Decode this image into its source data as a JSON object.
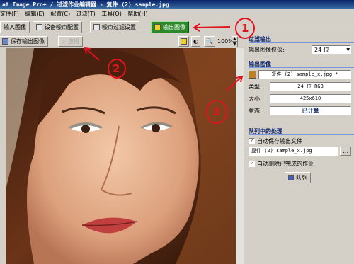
{
  "window": {
    "title": "at Image Pro+ / 过滤作业编辑器 - 复件 (2) sample.jpg"
  },
  "menu": [
    "文件(F)",
    "编辑(E)",
    "配置(C)",
    "过滤(T)",
    "工具(O)",
    "帮助(H)"
  ],
  "tabs": [
    "输入图像",
    "设备噪点配置",
    "噪点过滤设置",
    "输出图像"
  ],
  "toolbar": {
    "save_output": "保存输出图像",
    "apply": "应用",
    "zoom": "100%"
  },
  "filter_output": {
    "heading": "过滤输出",
    "bit_depth_label": "输出图像位深:",
    "bit_depth_value": "24 位"
  },
  "output_image": {
    "heading": "输出图像",
    "filename": "复件 (2) sample_x.jpg *",
    "type_label": "类型:",
    "type_value": "24 位 RGB",
    "size_label": "大小:",
    "size_value": "425x610",
    "status_label": "状态:",
    "status_value": "已计算"
  },
  "queue": {
    "heading": "队列中的处理",
    "autosave_label": "自动保存输出文件",
    "autosave_file": "复件 (2) sample_x.jpg",
    "browse": "...",
    "autodelete_label": "自动删除已完成的作业",
    "queue_button": "队列"
  },
  "annotations": {
    "one": "1",
    "two": "2",
    "three": "3"
  },
  "colors": {
    "annotation": "#e0141e",
    "active_tab": "#2a8a2a",
    "section_heading": "#0a246a",
    "status_value": "#0a246a"
  },
  "icons": [
    "disk-icon",
    "apply-icon",
    "photo-toggle-icon",
    "contrast-icon",
    "zoom-icon",
    "scroll-up-icon",
    "scroll-down-icon",
    "image-view-icon",
    "dropdown-arrow-icon",
    "checkbox-checked-icon",
    "queue-icon"
  ]
}
